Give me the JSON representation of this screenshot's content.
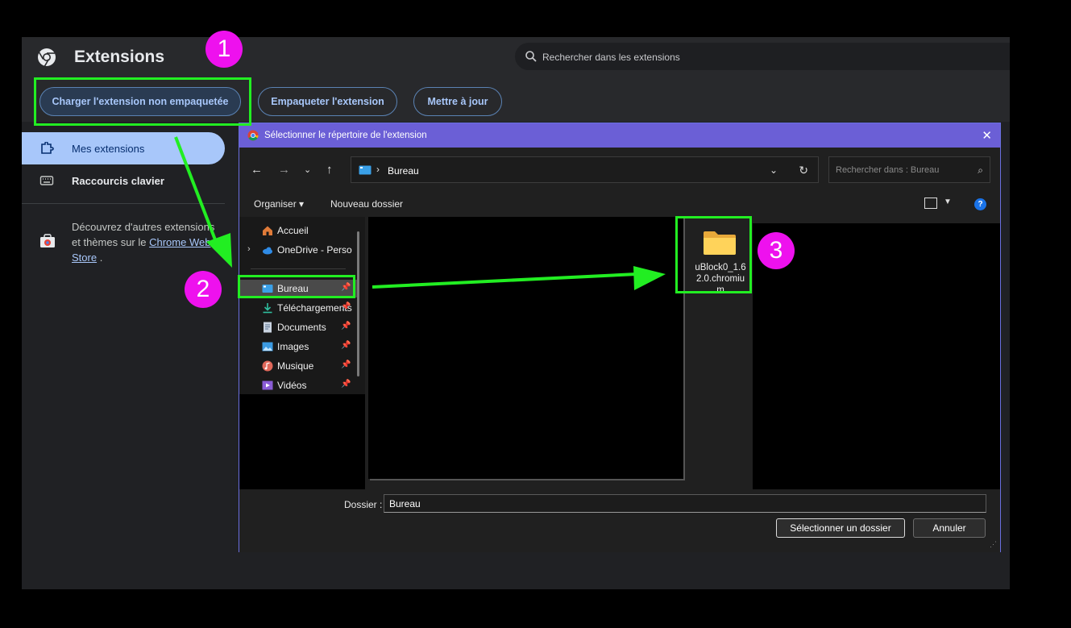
{
  "ext_page": {
    "title": "Extensions",
    "search_placeholder": "Rechercher dans les extensions",
    "buttons": {
      "load_unpacked": "Charger l'extension non empaquetée",
      "pack": "Empaqueter l'extension",
      "update": "Mettre à jour"
    },
    "nav": [
      {
        "label": "Mes extensions",
        "icon": "puzzle-icon"
      },
      {
        "label": "Raccourcis clavier",
        "icon": "keyboard-icon"
      }
    ],
    "store_blurb": {
      "text": "Découvrez d'autres extensions et thèmes sur le ",
      "link": "Chrome Web Store",
      "suffix": "."
    }
  },
  "dialog": {
    "title": "Sélectionner le répertoire de l'extension",
    "close_glyph": "✕",
    "address_path": "Bureau",
    "address_sep": "›",
    "search_placeholder": "Rechercher dans : Bureau",
    "organize_label": "Organiser",
    "new_folder_label": "Nouveau dossier",
    "help_glyph": "?",
    "tree": [
      {
        "label": "Accueil",
        "icon": "home-icon"
      },
      {
        "label": "OneDrive - Personnel",
        "icon": "cloud-icon"
      },
      {
        "label": "Bureau",
        "icon": "desktop-icon"
      },
      {
        "label": "Téléchargements",
        "icon": "download-icon"
      },
      {
        "label": "Documents",
        "icon": "document-icon"
      },
      {
        "label": "Images",
        "icon": "image-icon"
      },
      {
        "label": "Musique",
        "icon": "music-icon"
      },
      {
        "label": "Vidéos",
        "icon": "video-icon"
      }
    ],
    "file": {
      "name": "uBlock0_1.62.0.chromium",
      "icon": "folder-icon"
    },
    "footer": {
      "folder_label": "Dossier :",
      "folder_value": "Bureau",
      "select_label": "Sélectionner un dossier",
      "cancel_label": "Annuler"
    }
  },
  "annotations": {
    "badges": [
      "1",
      "2",
      "3"
    ],
    "highlight_color": "#22ee22",
    "badge_color": "#ee11ee"
  }
}
